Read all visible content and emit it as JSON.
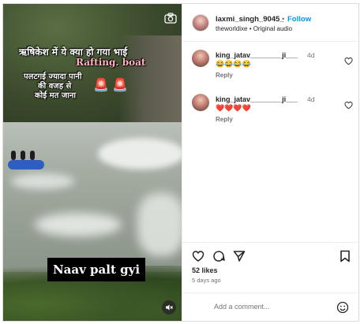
{
  "post": {
    "username": "laxmi_singh_9045_",
    "separator": "•",
    "follow_label": "Follow",
    "audio_line": "theworldixe • Original audio"
  },
  "video": {
    "overlay_line1": "ऋषिकेश में ये क्या हो गया भाई",
    "overlay_highlight": "Rafting. boat",
    "overlay_line2": "पलटगई ज्यादा पानी",
    "overlay_line3": "की वजह से",
    "overlay_line4": "कोई मत जाना",
    "siren_glyph": "🚨",
    "caption": "Naav palt gyi"
  },
  "comments": [
    {
      "user": "king_jatav________ji___",
      "time": "4d",
      "text": "😂😂😂😂",
      "reply_label": "Reply"
    },
    {
      "user": "king_jatav________ji___",
      "time": "4d",
      "text": "❤️❤️❤️❤️",
      "reply_label": "Reply"
    }
  ],
  "stats": {
    "likes": "52 likes",
    "ago": "5 days ago"
  },
  "composer": {
    "placeholder": "Add a comment..."
  },
  "colors": {
    "accent": "#0095f6",
    "muted": "#737373",
    "raft": "#2d5fc0"
  }
}
